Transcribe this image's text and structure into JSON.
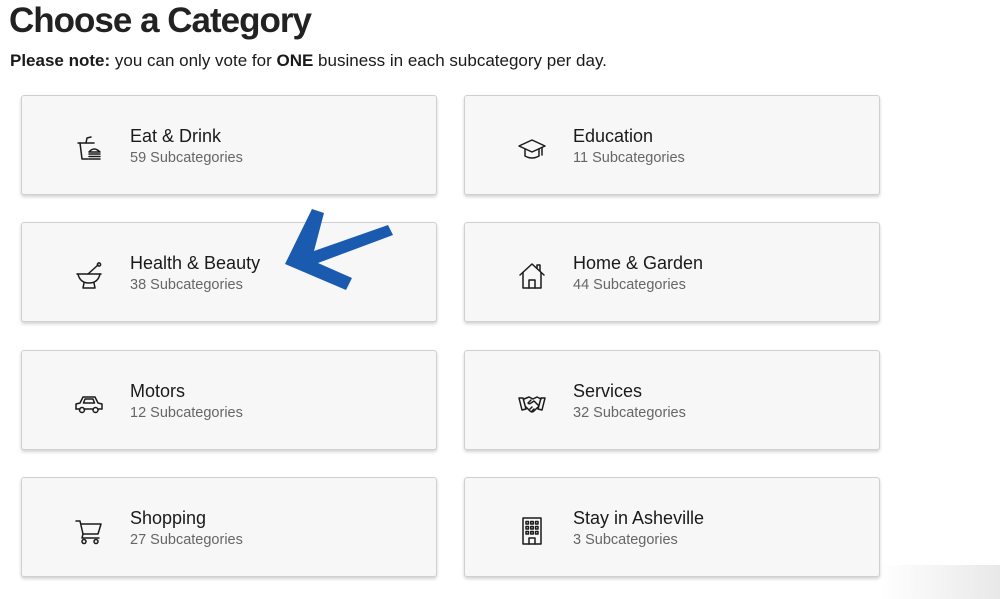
{
  "header": {
    "title": "Choose a Category",
    "note_label": "Please note:",
    "note_pre": " you can only vote for ",
    "note_emphasis": "ONE",
    "note_post": " business in each subcategory per day."
  },
  "categories": [
    {
      "name": "Eat & Drink",
      "count": "59 Subcategories",
      "icon": "food-plate-icon"
    },
    {
      "name": "Education",
      "count": "11 Subcategories",
      "icon": "graduation-cap-icon"
    },
    {
      "name": "Health & Beauty",
      "count": "38 Subcategories",
      "icon": "mortar-pestle-icon"
    },
    {
      "name": "Home & Garden",
      "count": "44 Subcategories",
      "icon": "house-icon"
    },
    {
      "name": "Motors",
      "count": "12 Subcategories",
      "icon": "car-icon"
    },
    {
      "name": "Services",
      "count": "32 Subcategories",
      "icon": "handshake-icon"
    },
    {
      "name": "Shopping",
      "count": "27 Subcategories",
      "icon": "shopping-cart-icon"
    },
    {
      "name": "Stay in Asheville",
      "count": "3 Subcategories",
      "icon": "hotel-building-icon"
    }
  ],
  "annotation": {
    "arrow_color": "#1a5bb0",
    "arrow_target": "Health & Beauty"
  }
}
